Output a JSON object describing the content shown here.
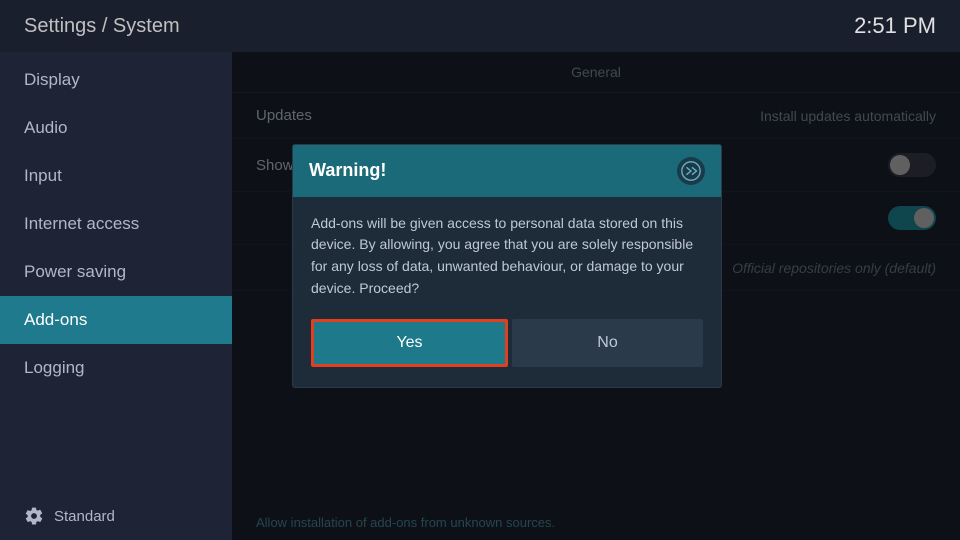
{
  "header": {
    "title": "Settings / System",
    "time": "2:51 PM"
  },
  "sidebar": {
    "items": [
      {
        "id": "display",
        "label": "Display",
        "active": false
      },
      {
        "id": "audio",
        "label": "Audio",
        "active": false
      },
      {
        "id": "input",
        "label": "Input",
        "active": false
      },
      {
        "id": "internet-access",
        "label": "Internet access",
        "active": false
      },
      {
        "id": "power-saving",
        "label": "Power saving",
        "active": false
      },
      {
        "id": "add-ons",
        "label": "Add-ons",
        "active": true
      },
      {
        "id": "logging",
        "label": "Logging",
        "active": false
      }
    ],
    "footer_label": "Standard"
  },
  "main": {
    "section_label": "General",
    "rows": [
      {
        "id": "updates",
        "label": "Updates",
        "value": "Install updates automatically",
        "type": "text"
      },
      {
        "id": "show-notifications",
        "label": "Show notifications",
        "type": "toggle",
        "enabled": false
      },
      {
        "id": "unknown-row",
        "label": "",
        "type": "toggle",
        "enabled": true
      },
      {
        "id": "repositories",
        "label": "",
        "value": "Official repositories only (default)",
        "type": "dropdown"
      }
    ],
    "footer_note": "Allow installation of add-ons from unknown sources."
  },
  "dialog": {
    "title": "Warning!",
    "body": "Add-ons will be given access to personal data stored on this device. By allowing, you agree that you are solely responsible for any loss of data, unwanted behaviour, or damage to your device. Proceed?",
    "btn_yes": "Yes",
    "btn_no": "No"
  }
}
